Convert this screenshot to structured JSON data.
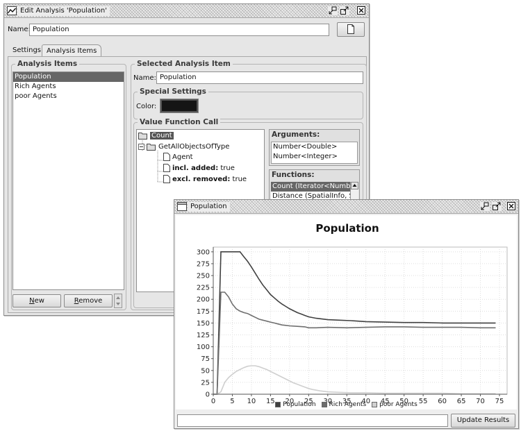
{
  "colors": {
    "selected_bg": "#666666",
    "window_bg": "#e6e6e6",
    "color_swatch": "#151515",
    "series_population": "#404040",
    "series_rich": "#6e6e6e",
    "series_poor": "#cfcfcf"
  },
  "editor": {
    "title": "Edit Analysis 'Population'",
    "title_icon": "chart-line-icon",
    "name_label": "Name:",
    "name_value": "Population",
    "new_doc_icon": "document-icon",
    "tabs": [
      {
        "label": "Settings",
        "active": false
      },
      {
        "label": "Analysis Items",
        "active": true
      }
    ],
    "items_group_title": "Analysis Items",
    "items": [
      {
        "label": "Population",
        "selected": true
      },
      {
        "label": "Rich Agents",
        "selected": false
      },
      {
        "label": "poor Agents",
        "selected": false
      }
    ],
    "new_button": {
      "mnemonic": "N",
      "rest": "ew"
    },
    "remove_button": {
      "mnemonic": "R",
      "rest": "emove"
    },
    "selected_group_title": "Selected Analysis Item",
    "selected_name_label": "Name:",
    "selected_name_value": "Population",
    "special_group_title": "Special Settings",
    "color_label": "Color:",
    "vfc_group_title": "Value Function Call",
    "tree": {
      "root": "Count",
      "child": "GetAllObjectsOfType",
      "leaf_agent": "Agent",
      "leaf_added_key": "incl. added:",
      "leaf_added_val": "true",
      "leaf_removed_key": "excl. removed:",
      "leaf_removed_val": "true"
    },
    "arguments_title": "Arguments:",
    "arguments": [
      "Number<Double>",
      "Number<Integer>"
    ],
    "functions_title": "Functions:",
    "functions": [
      {
        "label": "Count (Iterator<Number<",
        "selected": true
      },
      {
        "label": "Distance (SpatialInfo, Spat",
        "selected": false
      }
    ]
  },
  "chart_window": {
    "title": "Population",
    "input_value": "",
    "update_button": "Update Results"
  },
  "chart_data": {
    "type": "line",
    "title": "Population",
    "xlabel": "",
    "ylabel": "",
    "xlim": [
      0,
      77
    ],
    "ylim": [
      0,
      310
    ],
    "xticks": [
      0,
      5,
      10,
      15,
      20,
      25,
      30,
      35,
      40,
      45,
      50,
      55,
      60,
      65,
      70,
      75
    ],
    "yticks": [
      0,
      25,
      50,
      75,
      100,
      125,
      150,
      175,
      200,
      225,
      250,
      275,
      300
    ],
    "grid": true,
    "legend_position": "bottom",
    "series": [
      {
        "name": "Population",
        "color": "#404040",
        "points": [
          [
            0,
            0
          ],
          [
            1,
            0
          ],
          [
            2,
            300
          ],
          [
            3,
            300
          ],
          [
            4,
            300
          ],
          [
            5,
            300
          ],
          [
            6,
            300
          ],
          [
            7,
            300
          ],
          [
            8,
            290
          ],
          [
            9,
            280
          ],
          [
            10,
            268
          ],
          [
            11,
            255
          ],
          [
            12,
            242
          ],
          [
            13,
            230
          ],
          [
            14,
            220
          ],
          [
            15,
            210
          ],
          [
            16,
            203
          ],
          [
            17,
            196
          ],
          [
            18,
            190
          ],
          [
            19,
            185
          ],
          [
            20,
            180
          ],
          [
            21,
            176
          ],
          [
            22,
            172
          ],
          [
            23,
            169
          ],
          [
            24,
            166
          ],
          [
            25,
            163
          ],
          [
            27,
            160
          ],
          [
            30,
            157
          ],
          [
            33,
            156
          ],
          [
            36,
            155
          ],
          [
            40,
            153
          ],
          [
            45,
            152
          ],
          [
            50,
            151
          ],
          [
            55,
            151
          ],
          [
            60,
            150
          ],
          [
            65,
            150
          ],
          [
            70,
            150
          ],
          [
            74,
            150
          ]
        ]
      },
      {
        "name": "Rich Agents",
        "color": "#6e6e6e",
        "points": [
          [
            0,
            0
          ],
          [
            1,
            0
          ],
          [
            2,
            215
          ],
          [
            3,
            215
          ],
          [
            4,
            205
          ],
          [
            5,
            190
          ],
          [
            6,
            180
          ],
          [
            7,
            175
          ],
          [
            8,
            172
          ],
          [
            9,
            170
          ],
          [
            10,
            166
          ],
          [
            11,
            162
          ],
          [
            12,
            158
          ],
          [
            13,
            156
          ],
          [
            14,
            154
          ],
          [
            15,
            152
          ],
          [
            16,
            150
          ],
          [
            17,
            148
          ],
          [
            18,
            146
          ],
          [
            19,
            145
          ],
          [
            20,
            144
          ],
          [
            22,
            143
          ],
          [
            24,
            142
          ],
          [
            25,
            140
          ],
          [
            27,
            140
          ],
          [
            30,
            141
          ],
          [
            35,
            140
          ],
          [
            40,
            141
          ],
          [
            45,
            142
          ],
          [
            50,
            142
          ],
          [
            55,
            141
          ],
          [
            60,
            141
          ],
          [
            65,
            141
          ],
          [
            70,
            140
          ],
          [
            74,
            140
          ]
        ]
      },
      {
        "name": "poor Agents",
        "color": "#cfcfcf",
        "points": [
          [
            0,
            0
          ],
          [
            1,
            0
          ],
          [
            2,
            5
          ],
          [
            3,
            25
          ],
          [
            4,
            35
          ],
          [
            5,
            42
          ],
          [
            6,
            48
          ],
          [
            7,
            52
          ],
          [
            8,
            56
          ],
          [
            9,
            59
          ],
          [
            10,
            60
          ],
          [
            11,
            60
          ],
          [
            12,
            58
          ],
          [
            13,
            55
          ],
          [
            14,
            52
          ],
          [
            15,
            48
          ],
          [
            16,
            44
          ],
          [
            17,
            40
          ],
          [
            18,
            36
          ],
          [
            19,
            32
          ],
          [
            20,
            28
          ],
          [
            21,
            24
          ],
          [
            22,
            21
          ],
          [
            23,
            18
          ],
          [
            24,
            15
          ],
          [
            25,
            12
          ],
          [
            26,
            10
          ],
          [
            28,
            7
          ],
          [
            30,
            5
          ],
          [
            33,
            4
          ],
          [
            36,
            3
          ],
          [
            40,
            3
          ],
          [
            45,
            2
          ],
          [
            50,
            2
          ],
          [
            55,
            2
          ],
          [
            60,
            2
          ],
          [
            65,
            1
          ],
          [
            70,
            1
          ],
          [
            74,
            1
          ]
        ]
      }
    ]
  }
}
